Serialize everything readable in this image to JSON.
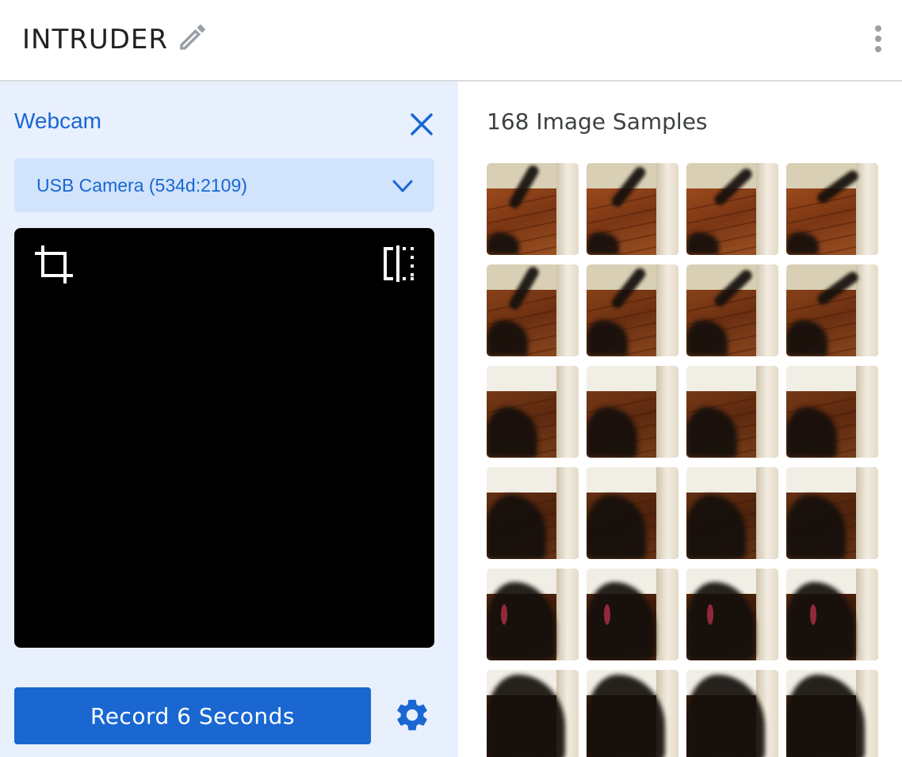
{
  "header": {
    "class_name": "INTRUDER",
    "edit_icon": "pencil-icon",
    "more_icon": "more-vert-icon"
  },
  "webcam": {
    "title": "Webcam",
    "close_icon": "close-icon",
    "camera_select": {
      "selected": "USB Camera (534d:2109)",
      "icon": "chevron-down-icon"
    },
    "preview": {
      "crop_icon": "crop-icon",
      "flip_icon": "flip-icon"
    },
    "record_button": "Record 6 Seconds",
    "settings_icon": "gear-icon"
  },
  "samples": {
    "count_label": "168 Image Samples",
    "visible_thumbnails": 24
  },
  "colors": {
    "accent": "#1967d2",
    "panel_bg": "#e8f0fe",
    "select_bg": "#d2e3fc",
    "button_bg": "#1a67d2"
  }
}
